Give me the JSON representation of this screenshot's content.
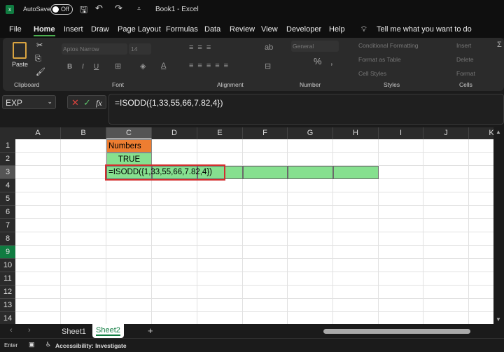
{
  "titlebar": {
    "autosave": "AutoSave",
    "toggle": "Off",
    "title": "Book1  -  Excel"
  },
  "menu": {
    "items": [
      "File",
      "Home",
      "Insert",
      "Draw",
      "Page Layout",
      "Formulas",
      "Data",
      "Review",
      "View",
      "Developer",
      "Help"
    ],
    "search": "Tell me what you want to do"
  },
  "ribbon": {
    "paste": "Paste",
    "font_name": "Aptos Narrow",
    "font_size": "14",
    "number_format": "General",
    "conditional_formatting": "Conditional Formatting",
    "format_as_table": "Format as Table",
    "cell_styles": "Cell Styles",
    "insert": "Insert",
    "delete": "Delete",
    "format": "Format",
    "groups": {
      "clipboard": "Clipboard",
      "font": "Font",
      "alignment": "Alignment",
      "number": "Number",
      "styles": "Styles",
      "cells": "Cells"
    },
    "bold": "B",
    "italic": "I",
    "underline": "U"
  },
  "formula_bar": {
    "name_box": "EXP",
    "fx": "fx",
    "formula": "=ISODD({1,33,55,66,7.82,4})"
  },
  "columns": [
    "A",
    "B",
    "C",
    "D",
    "E",
    "F",
    "G",
    "H",
    "I",
    "J",
    "K"
  ],
  "rows": [
    "1",
    "2",
    "3",
    "4",
    "5",
    "6",
    "7",
    "8",
    "9",
    "10",
    "11",
    "12",
    "13",
    "14"
  ],
  "cells": {
    "C1": "Numbers",
    "C2": "TRUE",
    "C3": "=ISODD({1,33,55,66,7.82,4})"
  },
  "colors": {
    "header_fill": "#ed7d31",
    "result_fill": "#86e08f",
    "selection_border": "#d32f2f",
    "accent": "#107c41"
  },
  "sheets": {
    "tabs": [
      "Sheet1",
      "Sheet2"
    ],
    "active": "Sheet2",
    "add": "+"
  },
  "status": {
    "mode": "Enter",
    "accessibility": "Accessibility: Investigate"
  }
}
